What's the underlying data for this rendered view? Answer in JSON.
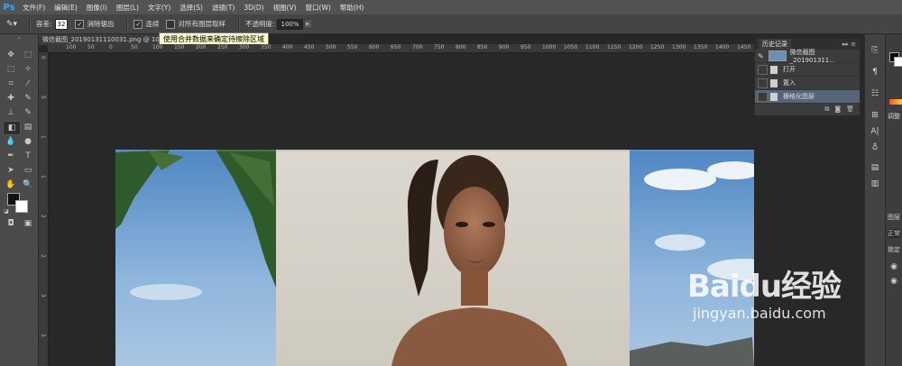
{
  "app": {
    "logo": "Ps"
  },
  "menu": {
    "items": [
      "文件(F)",
      "编辑(E)",
      "图像(I)",
      "图层(L)",
      "文字(Y)",
      "选择(S)",
      "滤镜(T)",
      "3D(D)",
      "视图(V)",
      "窗口(W)",
      "帮助(H)"
    ]
  },
  "options": {
    "tolerance_label": "容差:",
    "tolerance_value": "32",
    "antialias_label": "消除锯齿",
    "contiguous_label": "连续",
    "all_layers_label": "对所有图层取样",
    "opacity_label": "不透明度:",
    "opacity_value": "100%"
  },
  "document": {
    "tab_title": "微信截图_20190131110031.png @ 100%",
    "tooltip": "使用合并数据来确定待擦除区域"
  },
  "rulers": {
    "top": [
      "100",
      "50",
      "0",
      "50",
      "100",
      "150",
      "200",
      "250",
      "300",
      "350",
      "400",
      "450",
      "500",
      "550",
      "600",
      "650",
      "700",
      "750",
      "800",
      "850",
      "900",
      "950",
      "1000",
      "1050",
      "1100",
      "1150",
      "1200",
      "1250",
      "1300",
      "1350",
      "1400",
      "1450",
      "1500"
    ],
    "left": [
      "0",
      "5",
      "1",
      "1",
      "2",
      "2",
      "3",
      "3"
    ]
  },
  "history": {
    "title": "历史记录",
    "snapshot_label": "微信截图_201901311...",
    "items": [
      "打开",
      "置入",
      "栅格化图层"
    ],
    "selected_index": 2
  },
  "dock": {
    "labels": [
      "调整",
      "图层",
      "正常",
      "锁定"
    ]
  },
  "watermark": {
    "brand": "Baidu经验",
    "url": "jingyan.baidu.com"
  },
  "colors": {
    "accent": "#31a8ff",
    "selected_row": "#56657a",
    "tooltip_bg": "#fffccc"
  }
}
